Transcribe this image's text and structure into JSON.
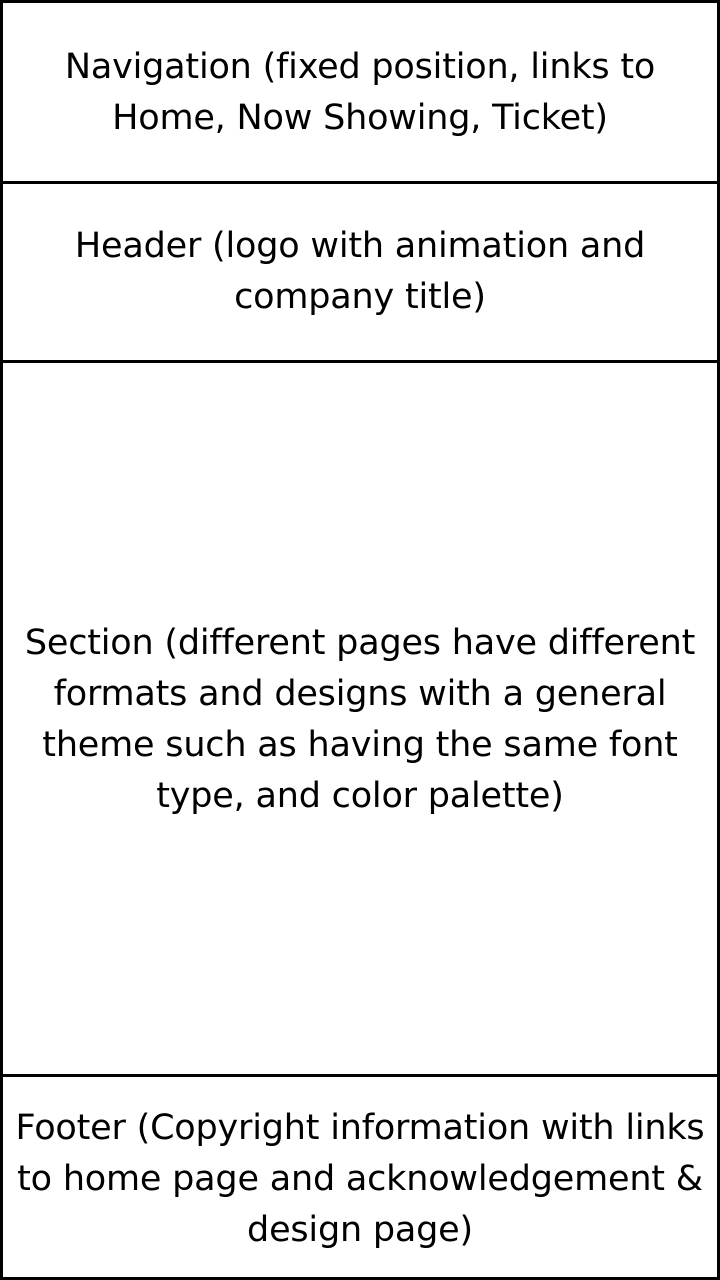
{
  "blocks": {
    "navigation": {
      "text": "Navigation (fixed position, links to Home, Now Showing, Ticket)"
    },
    "header": {
      "text": "Header (logo with animation and company title)"
    },
    "section": {
      "text": "Section (different pages have different formats and designs with a general theme such as having the same font type, and color palette)"
    },
    "footer": {
      "text": "Footer (Copyright information with links to home page and acknowledgement & design page)"
    }
  }
}
